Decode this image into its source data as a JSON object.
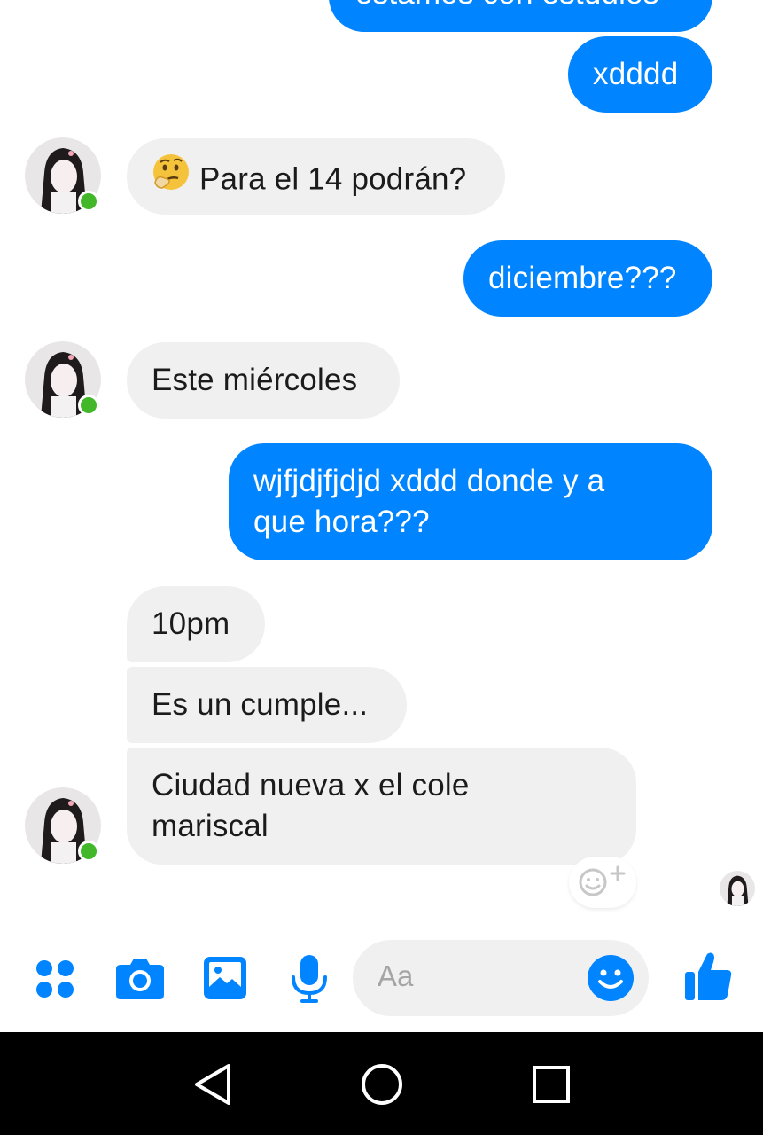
{
  "conversation": {
    "messages": [
      {
        "id": "m0",
        "direction": "outgoing",
        "text": "estamos con estudios"
      },
      {
        "id": "m1",
        "direction": "outgoing",
        "text": "xdddd"
      },
      {
        "id": "m2",
        "direction": "incoming",
        "emoji": "thinking-face",
        "text": "Para el 14 podrán?"
      },
      {
        "id": "m3",
        "direction": "outgoing",
        "text": "diciembre???"
      },
      {
        "id": "m4",
        "direction": "incoming",
        "text": "Este miércoles"
      },
      {
        "id": "m5",
        "direction": "outgoing",
        "lines": [
          "wjfjdjfjdjd xddd donde y a",
          "que hora???"
        ]
      },
      {
        "id": "m6",
        "direction": "incoming",
        "text": "10pm"
      },
      {
        "id": "m7",
        "direction": "incoming",
        "text": "Es un cumple..."
      },
      {
        "id": "m8",
        "direction": "incoming",
        "lines": [
          "Ciudad nueva x el cole",
          "mariscal"
        ]
      }
    ]
  },
  "contact": {
    "online": true
  },
  "composer": {
    "placeholder": "Aa",
    "icons": [
      "more-apps-icon",
      "camera-icon",
      "gallery-icon",
      "microphone-icon",
      "emoji-icon",
      "thumbs-up-icon"
    ]
  },
  "colors": {
    "outgoing_bubble": "#0084ff",
    "incoming_bubble": "#f0f0f0",
    "accent": "#0084ff",
    "online": "#42b72a"
  },
  "system_nav": {
    "icons": [
      "back-icon",
      "home-icon",
      "recents-icon"
    ]
  }
}
